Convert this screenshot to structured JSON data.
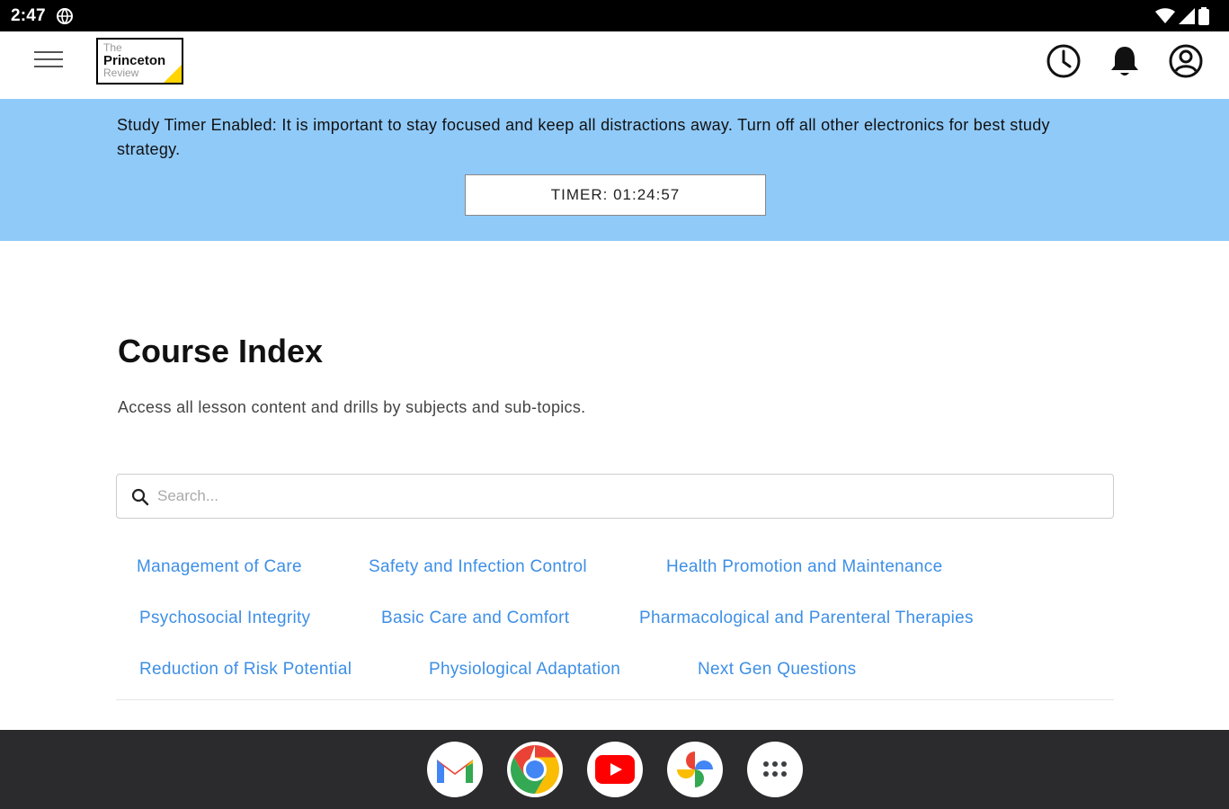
{
  "status_bar": {
    "time": "2:47"
  },
  "header": {
    "logo": {
      "line1": "The",
      "line2": "Princeton",
      "line3": "Review"
    }
  },
  "banner": {
    "message": "Study Timer Enabled: It is important to stay focused and keep all distractions away. Turn off all other electronics for best study strategy.",
    "timer": "TIMER: 01:24:57"
  },
  "main": {
    "title": "Course Index",
    "description": "Access all lesson content and drills by subjects and sub-topics.",
    "search": {
      "placeholder": "Search...",
      "value": ""
    },
    "topics": [
      [
        "Management of Care",
        "Safety and Infection Control",
        "Health Promotion and Maintenance"
      ],
      [
        "Psychosocial Integrity",
        "Basic Care and Comfort",
        "Pharmacological and Parenteral Therapies"
      ],
      [
        "Reduction of Risk Potential",
        "Physiological Adaptation",
        "Next Gen Questions"
      ]
    ]
  },
  "colors": {
    "banner_bg": "#90caf9",
    "link": "#3d8fe6",
    "dock_bg": "#2b2b2d",
    "logo_accent": "#ffd400"
  },
  "dock": {
    "apps": [
      "gmail-icon",
      "chrome-icon",
      "youtube-icon",
      "photos-icon",
      "app-drawer-icon"
    ]
  }
}
